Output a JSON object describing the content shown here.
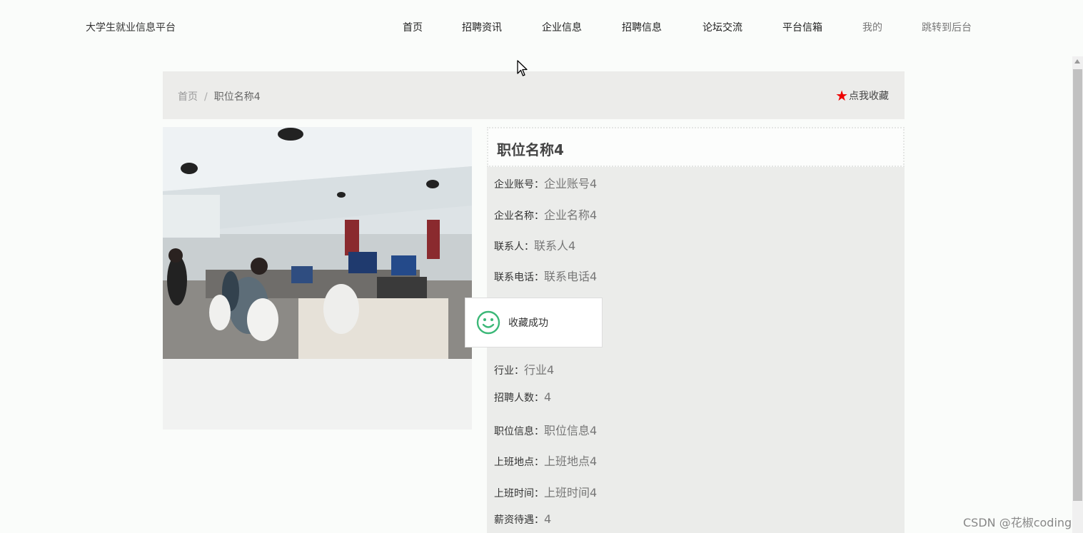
{
  "header": {
    "brand": "大学生就业信息平台",
    "nav": [
      "首页",
      "招聘资讯",
      "企业信息",
      "招聘信息",
      "论坛交流",
      "平台信箱",
      "我的",
      "跳转到后台"
    ]
  },
  "breadcrumb": {
    "home": "首页",
    "separator": "/",
    "current": "职位名称4"
  },
  "favorite": {
    "icon": "star-icon",
    "label": "点我收藏",
    "color": "#e00000"
  },
  "job": {
    "title": "职位名称4",
    "fields": [
      {
        "label": "企业账号：",
        "value": "企业账号4"
      },
      {
        "label": "企业名称：",
        "value": "企业名称4"
      },
      {
        "label": "联系人：",
        "value": "联系人4"
      },
      {
        "label": "联系电话：",
        "value": "联系电话4"
      },
      {
        "label": "行业：",
        "value": "行业4"
      },
      {
        "label": "招聘人数：",
        "value": "4"
      },
      {
        "label": "职位信息：",
        "value": "职位信息4"
      },
      {
        "label": "上班地点：",
        "value": "上班地点4"
      },
      {
        "label": "上班时间：",
        "value": "上班时间4"
      },
      {
        "label": "薪资待遇：",
        "value": "4"
      }
    ]
  },
  "toast": {
    "icon": "smile-icon",
    "text": "收藏成功",
    "icon_color": "#3cb878"
  },
  "watermark": "CSDN @花椒coding"
}
